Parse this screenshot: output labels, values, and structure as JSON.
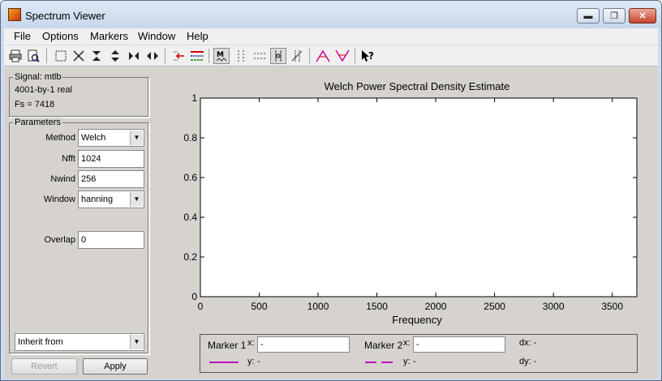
{
  "window": {
    "title": "Spectrum Viewer",
    "controls": {
      "minimize": "▬",
      "maximize": "❐",
      "close": "✕"
    }
  },
  "menu": [
    "File",
    "Options",
    "Markers",
    "Window",
    "Help"
  ],
  "signal": {
    "legend": "Signal: mtlb",
    "line1": "4001-by-1 real",
    "line2": "Fs = 7418"
  },
  "parameters": {
    "legend": "Parameters",
    "method_label": "Method",
    "method_value": "Welch",
    "nfft_label": "Nfft",
    "nfft_value": "1024",
    "nwind_label": "Nwind",
    "nwind_value": "256",
    "window_label": "Window",
    "window_value": "hanning",
    "overlap_label": "Overlap",
    "overlap_value": "0",
    "inherit_value": "Inherit from"
  },
  "buttons": {
    "revert": "Revert",
    "apply": "Apply"
  },
  "chart_data": {
    "type": "line",
    "title": "Welch Power Spectral Density Estimate",
    "xlabel": "Frequency",
    "ylabel": "",
    "xlim": [
      0,
      3709
    ],
    "ylim": [
      0,
      1
    ],
    "xticks": [
      0,
      500,
      1000,
      1500,
      2000,
      2500,
      3000,
      3500
    ],
    "yticks": [
      0,
      0.2,
      0.4,
      0.6,
      0.8,
      1
    ],
    "ytick_labels": [
      "0",
      "0.2",
      "0.4",
      "0.6",
      "0.8",
      "1"
    ],
    "series": [],
    "grid": false
  },
  "markers": {
    "m1_label": "Marker 1",
    "m1_x_label": "x:",
    "m1_x_value": "-",
    "m1_y_label": "y:",
    "m1_y_value": "-",
    "m1_color": "#c000c0",
    "m2_label": "Marker 2",
    "m2_x_label": "x:",
    "m2_x_value": "-",
    "m2_y_label": "y:",
    "m2_y_value": "-",
    "m2_color": "#c000c0",
    "dx": "dx: -",
    "dy": "dy: -"
  },
  "colors": {
    "frame": "#cfdced",
    "panel": "#d6d3ce"
  }
}
